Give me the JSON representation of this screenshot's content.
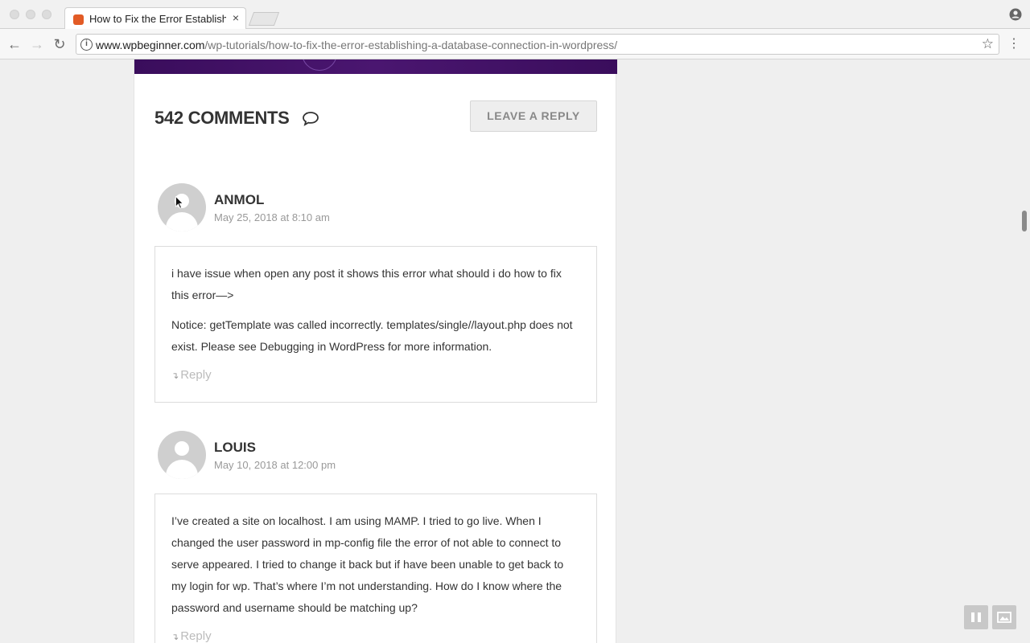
{
  "browser": {
    "tab_title": "How to Fix the Error Establishi",
    "tab_close": "×",
    "url_host": "www.wpbeginner.com",
    "url_path": "/wp-tutorials/how-to-fix-the-error-establishing-a-database-connection-in-wordpress/",
    "info_glyph": "i",
    "star_glyph": "☆",
    "menu_glyph": "⋮",
    "back_glyph": "←",
    "forward_glyph": "→",
    "reload_glyph": "↻"
  },
  "comments_section": {
    "heading": "542 COMMENTS",
    "leave_reply_label": "LEAVE A REPLY"
  },
  "comments": [
    {
      "author": "ANMOL",
      "date": "May 25, 2018 at 8:10 am",
      "paragraphs": [
        "i have issue when open any post it shows this error what should i do how to fix this error—>",
        "Notice: getTemplate was called incorrectly. templates/single//layout.php does not exist. Please see Debugging in WordPress for more information."
      ],
      "reply_label": "Reply"
    },
    {
      "author": "LOUIS",
      "date": "May 10, 2018 at 12:00 pm",
      "paragraphs": [
        "I’ve created a site on localhost. I am using MAMP. I tried to go live. When I changed the user password in mp-config file the error of not able to connect to serve appeared. I tried to change it back but if have been unable to get back to my login for wp. That’s where I’m not understanding. How do I know where the password and username should be matching up?"
      ],
      "reply_label": "Reply"
    }
  ],
  "reply_arrow_glyph": "↴",
  "colors": {
    "banner": "#3a0d5c",
    "favicon": "#e25b25"
  }
}
